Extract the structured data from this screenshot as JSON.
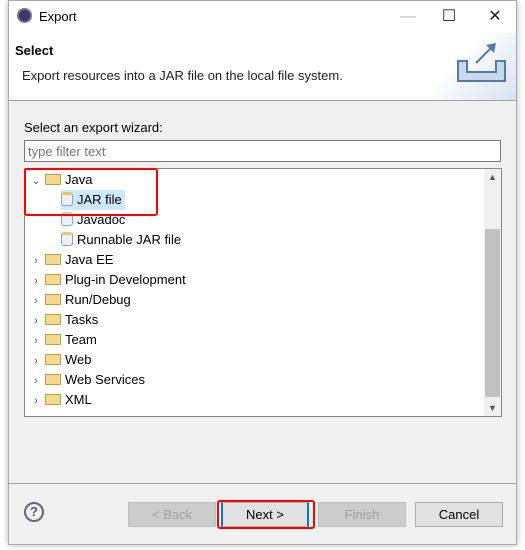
{
  "window": {
    "title": "Export"
  },
  "header": {
    "title": "Select",
    "description": "Export resources into a JAR file on the local file system."
  },
  "wizard": {
    "label": "Select an export wizard:",
    "filter_placeholder": "type filter text"
  },
  "tree": {
    "java": {
      "label": "Java",
      "children": [
        "JAR file",
        "Javadoc",
        "Runnable JAR file"
      ],
      "selected": "JAR file"
    },
    "categories": [
      "Java EE",
      "Plug-in Development",
      "Run/Debug",
      "Tasks",
      "Team",
      "Web",
      "Web Services",
      "XML"
    ]
  },
  "buttons": {
    "back": "< Back",
    "next": "Next >",
    "finish": "Finish",
    "cancel": "Cancel"
  },
  "colors": {
    "highlight": "#ff0000",
    "selection": "#cce8ff"
  }
}
